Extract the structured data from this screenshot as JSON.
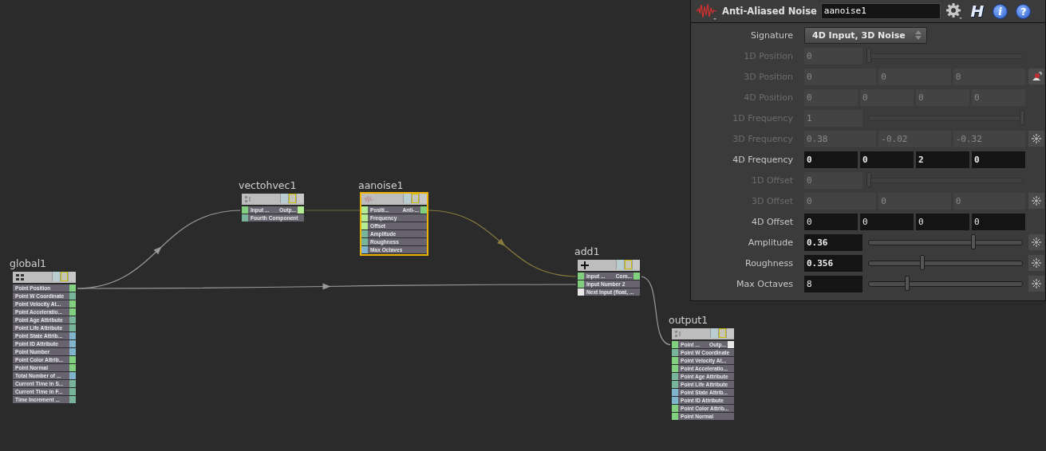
{
  "network": {
    "nodes": [
      {
        "name": "global1",
        "kind": "source",
        "selected": false,
        "rows": [
          {
            "label": "Point Position",
            "color": "#80d080"
          },
          {
            "label": "Point W  Coordinate",
            "color": "#78b49a"
          },
          {
            "label": "Point Velocity At...",
            "color": "#80d080"
          },
          {
            "label": "Point Acceleratio...",
            "color": "#80d080"
          },
          {
            "label": "Point Age Attribute",
            "color": "#78b49a"
          },
          {
            "label": "Point Life Attribute",
            "color": "#78b49a"
          },
          {
            "label": "Point State Attrib...",
            "color": "#80b4cc"
          },
          {
            "label": "Point ID Attribute",
            "color": "#80b4cc"
          },
          {
            "label": "Point Number",
            "color": "#80b4cc"
          },
          {
            "label": "Point Color Attrib...",
            "color": "#80d080"
          },
          {
            "label": "Point Normal",
            "color": "#80d080"
          },
          {
            "label": "Total Number of ...",
            "color": "#80b4cc"
          },
          {
            "label": "Current Time in S...",
            "color": "#78b49a"
          },
          {
            "label": "Current Time in F...",
            "color": "#78b49a"
          },
          {
            "label": "Time Increment ...",
            "color": "#78b49a"
          }
        ]
      },
      {
        "name": "vectohvec1",
        "kind": "operator",
        "selected": false,
        "output": {
          "label": "Outp...",
          "color": "#b4ec94"
        },
        "rows": [
          {
            "label": "Input ...",
            "color": "#80d080"
          },
          {
            "label": "Fourth Component",
            "color": "#78b49a"
          }
        ]
      },
      {
        "name": "aanoise1",
        "kind": "operator",
        "selected": true,
        "output": {
          "label": "Anti-...",
          "color": "#80d080"
        },
        "rows": [
          {
            "label": "Positi...",
            "color": "#b4ec94"
          },
          {
            "label": "Frequency",
            "color": "#b4ec94"
          },
          {
            "label": "Offset",
            "color": "#b4ec94"
          },
          {
            "label": "Amplitude",
            "color": "#78b49a"
          },
          {
            "label": "Roughness",
            "color": "#78b49a"
          },
          {
            "label": "Max Octaves",
            "color": "#80b4cc"
          }
        ]
      },
      {
        "name": "add1",
        "kind": "operator",
        "selected": false,
        "output": {
          "label": "Com...",
          "color": "#80d080"
        },
        "rows": [
          {
            "label": "Input ...",
            "color": "#80d080"
          },
          {
            "label": "Input Number 2",
            "color": "#80d080"
          },
          {
            "label": "Next Input (float, ...",
            "color": "#e8e8e8"
          }
        ]
      },
      {
        "name": "output1",
        "kind": "operator",
        "selected": false,
        "output": {
          "label": "Outp...",
          "color": "#e8e8e8"
        },
        "rows": [
          {
            "label": "Point ...",
            "color": "#80d080"
          },
          {
            "label": "Point W  Coordinate",
            "color": "#78b49a"
          },
          {
            "label": "Point Velocity At...",
            "color": "#80d080"
          },
          {
            "label": "Point Acceleratio...",
            "color": "#80d080"
          },
          {
            "label": "Point Age Attribute",
            "color": "#78b49a"
          },
          {
            "label": "Point Life Attribute",
            "color": "#78b49a"
          },
          {
            "label": "Point State Attrib...",
            "color": "#80b4cc"
          },
          {
            "label": "Point ID Attribute",
            "color": "#80b4cc"
          },
          {
            "label": "Point Color Attrib...",
            "color": "#80d080"
          },
          {
            "label": "Point Normal",
            "color": "#80d080"
          }
        ]
      }
    ]
  },
  "parameters": {
    "node_type": "Anti-Aliased Noise",
    "node_name": "aanoise1",
    "header_buttons": [
      {
        "kind": "gear"
      },
      {
        "kind": "letter",
        "glyph": "H"
      },
      {
        "kind": "info",
        "glyph": "i"
      },
      {
        "kind": "help",
        "glyph": "?"
      }
    ],
    "rows": [
      {
        "label": "Signature",
        "kind": "menu",
        "value": "4D Input, 3D Noise"
      },
      {
        "label": "1D Position",
        "kind": "slider",
        "values": [
          "0"
        ],
        "level": 0,
        "disabled": true,
        "modified": false
      },
      {
        "label": "3D Position",
        "kind": "vector",
        "values": [
          "0",
          "0",
          "0"
        ],
        "disabled": true,
        "modified": false
      },
      {
        "label": "4D Position",
        "kind": "vector",
        "values": [
          "0",
          "0",
          "0",
          "0"
        ],
        "disabled": true,
        "modified": false
      },
      {
        "label": "1D Frequency",
        "kind": "slider",
        "values": [
          "1"
        ],
        "level": 1,
        "disabled": true,
        "modified": false
      },
      {
        "label": "3D Frequency",
        "kind": "vector",
        "values": [
          "0.38",
          "-0.02",
          "-0.32"
        ],
        "disabled": true,
        "modified": false
      },
      {
        "label": "4D Frequency",
        "kind": "vector",
        "values": [
          "0",
          "0",
          "2",
          "0"
        ],
        "disabled": false,
        "modified": true
      },
      {
        "label": "1D Offset",
        "kind": "slider",
        "values": [
          "0"
        ],
        "level": 0,
        "disabled": true,
        "modified": false
      },
      {
        "label": "3D Offset",
        "kind": "vector",
        "values": [
          "0",
          "0",
          "0"
        ],
        "disabled": true,
        "modified": false
      },
      {
        "label": "4D Offset",
        "kind": "vector",
        "values": [
          "0",
          "0",
          "0",
          "0"
        ],
        "disabled": false,
        "modified": false
      },
      {
        "label": "Amplitude",
        "kind": "slider",
        "values": [
          "0.36"
        ],
        "level": 0.68,
        "disabled": false,
        "modified": true
      },
      {
        "label": "Roughness",
        "kind": "slider",
        "values": [
          "0.356"
        ],
        "level": 0.35,
        "disabled": false,
        "modified": true
      },
      {
        "label": "Max Octaves",
        "kind": "slider",
        "values": [
          "8"
        ],
        "level": 0.25,
        "disabled": false,
        "modified": false
      }
    ]
  }
}
